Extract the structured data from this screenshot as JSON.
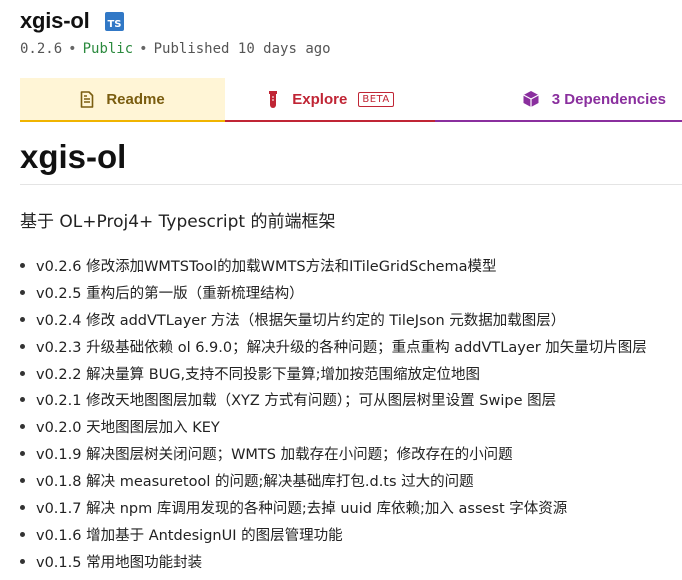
{
  "package": {
    "name": "xgis-ol",
    "ts_badge": "TS",
    "version": "0.2.6",
    "visibility": "Public",
    "published": "Published 10 days ago",
    "separator": "•"
  },
  "tabs": [
    {
      "label": "Readme",
      "icon": "readme-file-icon",
      "color": "#7a5d10"
    },
    {
      "label": "Explore",
      "icon": "explore-vial-icon",
      "badge": "BETA",
      "color": "#c02535"
    },
    {
      "label": "3 Dependencies",
      "icon": "dependencies-cube-icon",
      "color": "#8a2f9e"
    }
  ],
  "readme": {
    "heading": "xgis-ol",
    "description": "基于 OL+Proj4+ Typescript 的前端框架",
    "changelog": [
      "v0.2.6 修改添加WMTSTool的加载WMTS方法和ITileGridSchema模型",
      "v0.2.5 重构后的第一版（重新梳理结构）",
      "v0.2.4 修改 addVTLayer 方法（根据矢量切片约定的 TileJson 元数据加载图层）",
      "v0.2.3 升级基础依赖 ol 6.9.0；解决升级的各种问题；重点重构 addVTLayer 加矢量切片图层",
      "v0.2.2 解决量算 BUG,支持不同投影下量算;增加按范围缩放定位地图",
      "v0.2.1 修改天地图图层加载（XYZ 方式有问题）；可从图层树里设置 Swipe 图层",
      "v0.2.0 天地图图层加入 KEY",
      "v0.1.9 解决图层树关闭问题；WMTS 加载存在小问题；修改存在的小问题",
      "v0.1.8 解决 measuretool 的问题;解决基础库打包.d.ts 过大的问题",
      "v0.1.7 解决 npm 库调用发现的各种问题;去掉 uuid 库依赖;加入 assest 字体资源",
      "v0.1.6 增加基于 AntdesignUI 的图层管理功能",
      "v0.1.5 常用地图功能封装"
    ]
  }
}
